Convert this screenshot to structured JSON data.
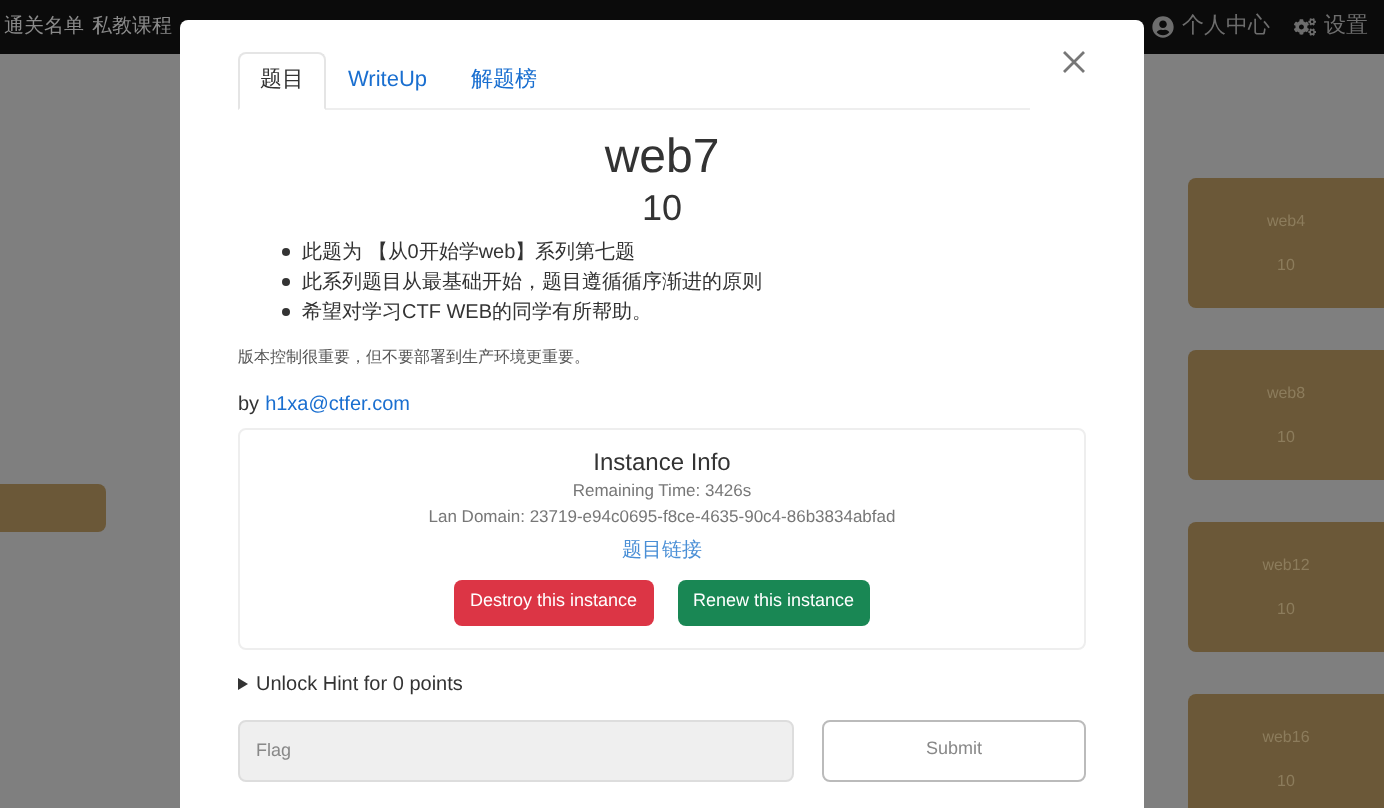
{
  "navbar": {
    "links": [
      "通关名单",
      "私教课程"
    ],
    "right_items": [
      {
        "kind": "user",
        "label": "个人中心"
      },
      {
        "kind": "settings",
        "label": "设置"
      }
    ]
  },
  "background_cards": [
    {
      "name": "web4",
      "points": "10"
    },
    {
      "name": "web8",
      "points": "10"
    },
    {
      "name": "web12",
      "points": "10"
    },
    {
      "name": "web16",
      "points": "10"
    }
  ],
  "modal": {
    "tabs": [
      {
        "label": "题目",
        "selected": true
      },
      {
        "label": "WriteUp",
        "selected": false
      },
      {
        "label": "解题榜",
        "selected": false
      }
    ],
    "title": "web7",
    "points": "10",
    "bullets": [
      "此题为 【从0开始学web】系列第七题",
      "此系列题目从最基础开始，题目遵循循序渐进的原则",
      "希望对学习CTF WEB的同学有所帮助。"
    ],
    "note": "版本控制很重要，但不要部署到生产环境更重要。",
    "author_prefix": "by",
    "author": "h1xa@ctfer.com",
    "instance": {
      "title": "Instance Info",
      "remaining": "Remaining Time: 3426s",
      "domain": "Lan Domain: 23719-e94c0695-f8ce-4635-90c4-86b3834abfad",
      "link": "题目链接",
      "buttons": [
        {
          "kind": "danger",
          "label": "Destroy this instance"
        },
        {
          "kind": "success",
          "label": "Renew this instance"
        }
      ]
    },
    "hint": "Unlock Hint for 0 points",
    "flag": {
      "placeholder": "Flag"
    },
    "submit": "Submit"
  }
}
